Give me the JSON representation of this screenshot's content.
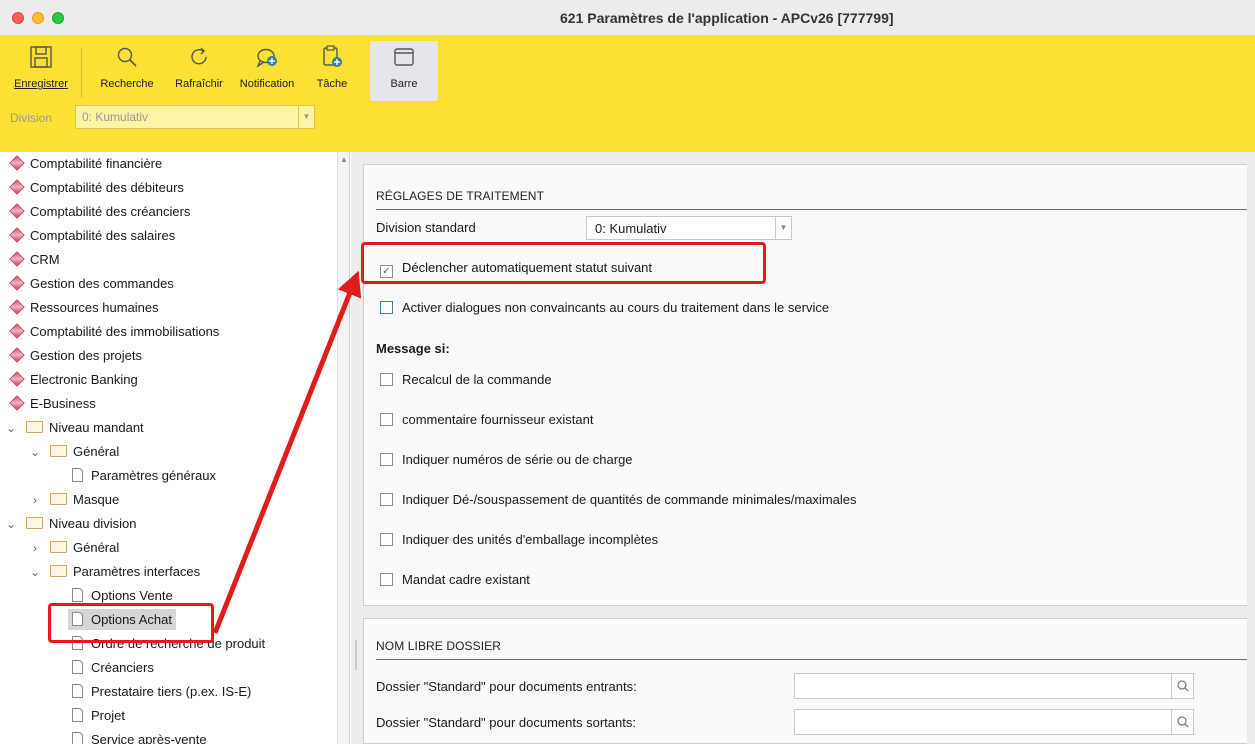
{
  "window": {
    "title": "621 Paramètres de l'application - APCv26 [777799]"
  },
  "toolbar": {
    "buttons": [
      {
        "label": "Enregistrer",
        "icon": "save-icon"
      },
      {
        "label": "Recherche",
        "icon": "search-icon"
      },
      {
        "label": "Rafraîchir",
        "icon": "refresh-icon"
      },
      {
        "label": "Notification",
        "icon": "notification-add-icon"
      },
      {
        "label": "Tâche",
        "icon": "task-add-icon"
      },
      {
        "label": "Barre",
        "icon": "window-bar-icon"
      }
    ],
    "division_label": "Division",
    "division_value": "0: Kumulativ"
  },
  "tree": {
    "modules": [
      "Comptabilité financière",
      "Comptabilité des débiteurs",
      "Comptabilité des créanciers",
      "Comptabilité des salaires",
      "CRM",
      "Gestion des commandes",
      "Ressources humaines",
      "Comptabilité des immobilisations",
      "Gestion des projets",
      "Electronic Banking",
      "E-Business"
    ],
    "niveau_mandant": "Niveau mandant",
    "general_1": "Général",
    "parametres_generaux": "Paramètres généraux",
    "masque": "Masque",
    "niveau_division": "Niveau division",
    "general_2": "Général",
    "parametres_interfaces": "Paramètres interfaces",
    "options_vente": "Options Vente",
    "options_achat": "Options Achat",
    "ordre_recherche": "Ordre de recherche de produit",
    "creanciers": "Créanciers",
    "prestataire": "Prestataire tiers (p.ex. IS-E)",
    "projet": "Projet",
    "service": "Service après-vente"
  },
  "processing": {
    "header": "RÉGLAGES DE TRAITEMENT",
    "division_standard_label": "Division standard",
    "division_standard_value": "0: Kumulativ",
    "auto_status_label": "Déclencher automatiquement statut suivant",
    "auto_status_checked": true,
    "dialogs_label": "Activer dialogues non convaincants au cours du traitement dans le service",
    "dialogs_checked": false,
    "message_si": "Message si:",
    "messages": [
      "Recalcul de la commande",
      "commentaire fournisseur existant",
      "Indiquer numéros de série ou de charge",
      "Indiquer Dé-/souspassement de quantités de commande minimales/maximales",
      "Indiquer des unités d'emballage incomplètes",
      "Mandat cadre existant"
    ]
  },
  "folders": {
    "header": "NOM LIBRE DOSSIER",
    "incoming_label": "Dossier \"Standard\" pour documents entrants:",
    "incoming_value": "",
    "outgoing_label": "Dossier \"Standard\" pour documents sortants:",
    "outgoing_value": ""
  },
  "colors": {
    "toolbar_bg": "#fbe133",
    "annotation_red": "#e21b1b",
    "rule_blue": "#4a6f9a"
  }
}
